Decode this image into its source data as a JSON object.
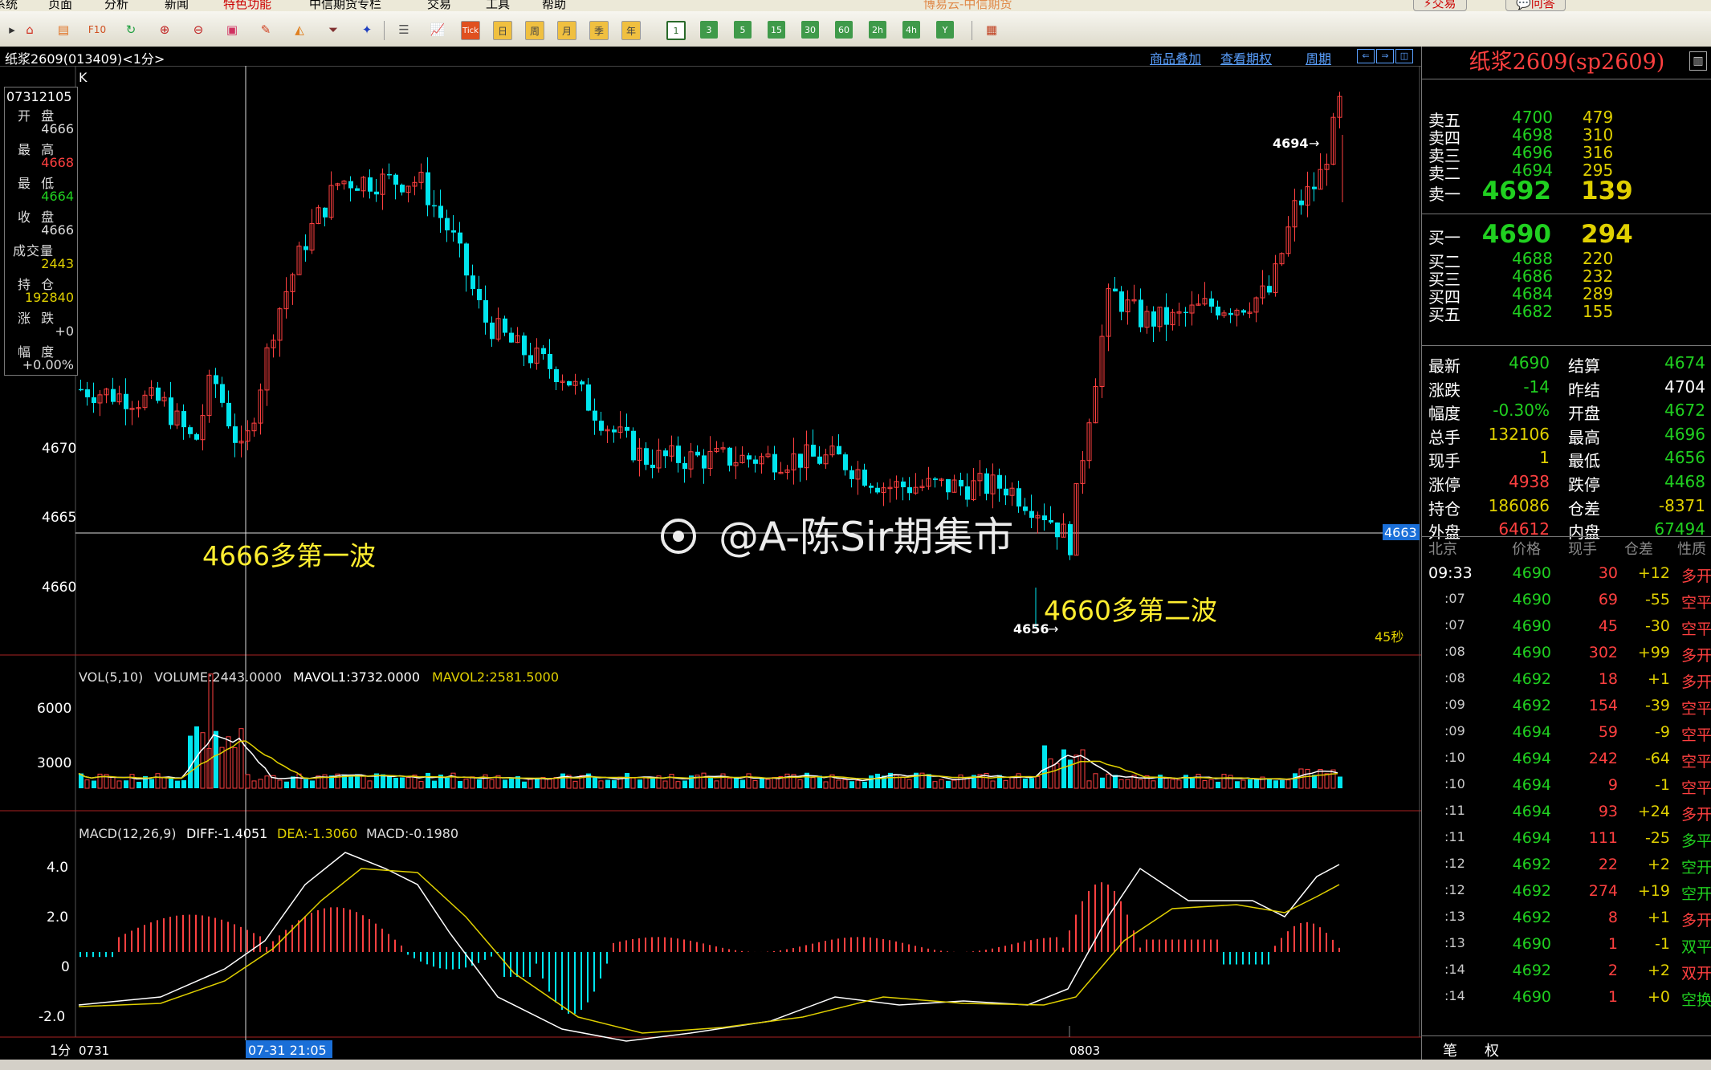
{
  "menu": {
    "items": [
      "系统",
      "页面",
      "分析",
      "新闻",
      "特色功能",
      "中信期货专栏",
      "交易",
      "工具",
      "帮助"
    ],
    "app_title": "博易云-中信期货",
    "trade_btn": "交易",
    "ask_btn": "问答"
  },
  "toolbar": {
    "periods": [
      "1",
      "3",
      "5",
      "15",
      "30",
      "60",
      "2h",
      "4h",
      "Y"
    ],
    "selected_period": "1",
    "tick_label": "Tick",
    "day_label": "日",
    "week_label": "周",
    "month_label": "月",
    "season_label": "季",
    "year_label": "年"
  },
  "chart": {
    "title": "纸浆2609(013409)<1分>",
    "links": {
      "overlay": "商品叠加",
      "options": "查看期权",
      "period": "周期"
    },
    "k_label": "K",
    "price_labels": [
      "4670",
      "4665",
      "4660"
    ],
    "vol_labels": [
      "6000",
      "3000"
    ],
    "macd_labels": [
      "4.0",
      "2.0",
      "0",
      "-2.0"
    ],
    "high_marker": "4694",
    "low_marker": "4656",
    "crosshair_price": "4663",
    "countdown": "45秒",
    "annotation1": "4666多第一波",
    "annotation2": "4660多第二波",
    "watermark": "@A-陈Sir期集市",
    "vol_info": {
      "name": "VOL(5,10)",
      "volume": "VOLUME:2443.0000",
      "mavol1": "MAVOL1:3732.0000",
      "mavol2": "MAVOL2:2581.5000"
    },
    "macd_info": {
      "name": "MACD(12,26,9)",
      "diff": "DIFF:-1.4051",
      "dea": "DEA:-1.3060",
      "macd": "MACD:-0.1980"
    },
    "axis": {
      "period": "1分",
      "date1": "0731",
      "cursor_time": "07-31 21:05",
      "date2": "0803"
    },
    "colors": {
      "up": "#ff4040",
      "down": "#00e5ee",
      "ma1": "#ffffff",
      "ma2": "#e0d000",
      "bg": "#000000"
    }
  },
  "data_window": {
    "time": "07312105",
    "labels": [
      "开 盘",
      "最 高",
      "最 低",
      "收 盘",
      "成交量",
      "持 仓",
      "涨 跌",
      "幅 度"
    ],
    "values": [
      "4666",
      "4668",
      "4664",
      "4666",
      "2443",
      "192840",
      "+0",
      "+0.00%"
    ],
    "value_colors": [
      "#dddddd",
      "#ff4040",
      "#20d020",
      "#dddddd",
      "#e0d000",
      "#e0d000",
      "#dddddd",
      "#dddddd"
    ]
  },
  "quote": {
    "title": "纸浆2609(sp2609)",
    "asks": [
      {
        "label": "卖五",
        "price": "4700",
        "vol": "479"
      },
      {
        "label": "卖四",
        "price": "4698",
        "vol": "310"
      },
      {
        "label": "卖三",
        "price": "4696",
        "vol": "316"
      },
      {
        "label": "卖二",
        "price": "4694",
        "vol": "295"
      },
      {
        "label": "卖一",
        "price": "4692",
        "vol": "139"
      }
    ],
    "bids": [
      {
        "label": "买一",
        "price": "4690",
        "vol": "294"
      },
      {
        "label": "买二",
        "price": "4688",
        "vol": "220"
      },
      {
        "label": "买三",
        "price": "4686",
        "vol": "232"
      },
      {
        "label": "买四",
        "price": "4684",
        "vol": "289"
      },
      {
        "label": "买五",
        "price": "4682",
        "vol": "155"
      }
    ],
    "stats": [
      {
        "l1": "最新",
        "v1": "4690",
        "c1": "#20d020",
        "l2": "结算",
        "v2": "4674",
        "c2": "#20d020"
      },
      {
        "l1": "涨跌",
        "v1": "-14",
        "c1": "#20d020",
        "l2": "昨结",
        "v2": "4704",
        "c2": "#ffffff"
      },
      {
        "l1": "幅度",
        "v1": "-0.30%",
        "c1": "#20d020",
        "l2": "开盘",
        "v2": "4672",
        "c2": "#20d020"
      },
      {
        "l1": "总手",
        "v1": "132106",
        "c1": "#e0d000",
        "l2": "最高",
        "v2": "4696",
        "c2": "#20d020"
      },
      {
        "l1": "现手",
        "v1": "1",
        "c1": "#e0d000",
        "l2": "最低",
        "v2": "4656",
        "c2": "#20d020"
      },
      {
        "l1": "涨停",
        "v1": "4938",
        "c1": "#ff4040",
        "l2": "跌停",
        "v2": "4468",
        "c2": "#20d020"
      },
      {
        "l1": "持仓",
        "v1": "186086",
        "c1": "#e0d000",
        "l2": "仓差",
        "v2": "-8371",
        "c2": "#e0d000"
      },
      {
        "l1": "外盘",
        "v1": "64612",
        "c1": "#ff4040",
        "l2": "内盘",
        "v2": "67494",
        "c2": "#20d020"
      }
    ],
    "tick_headers": [
      "北京",
      "价格",
      "现手",
      "仓差",
      "性质"
    ],
    "ticks": [
      {
        "t": "09:33",
        "p": "4690",
        "v": "30",
        "d": "+12",
        "n": "多开",
        "nc": "#ff4040"
      },
      {
        "t": ":07",
        "p": "4690",
        "v": "69",
        "d": "-55",
        "n": "空平",
        "nc": "#ff4040"
      },
      {
        "t": ":07",
        "p": "4690",
        "v": "45",
        "d": "-30",
        "n": "空平",
        "nc": "#ff4040"
      },
      {
        "t": ":08",
        "p": "4690",
        "v": "302",
        "d": "+99",
        "n": "多开",
        "nc": "#ff4040"
      },
      {
        "t": ":08",
        "p": "4692",
        "v": "18",
        "d": "+1",
        "n": "多开",
        "nc": "#ff4040"
      },
      {
        "t": ":09",
        "p": "4692",
        "v": "154",
        "d": "-39",
        "n": "空平",
        "nc": "#ff4040"
      },
      {
        "t": ":09",
        "p": "4694",
        "v": "59",
        "d": "-9",
        "n": "空平",
        "nc": "#ff4040"
      },
      {
        "t": ":10",
        "p": "4694",
        "v": "242",
        "d": "-64",
        "n": "空平",
        "nc": "#ff4040"
      },
      {
        "t": ":10",
        "p": "4694",
        "v": "9",
        "d": "-1",
        "n": "空平",
        "nc": "#ff4040"
      },
      {
        "t": ":11",
        "p": "4694",
        "v": "93",
        "d": "+24",
        "n": "多开",
        "nc": "#ff4040"
      },
      {
        "t": ":11",
        "p": "4694",
        "v": "111",
        "d": "-25",
        "n": "多平",
        "nc": "#20d020"
      },
      {
        "t": ":12",
        "p": "4692",
        "v": "22",
        "d": "+2",
        "n": "空开",
        "nc": "#20d020"
      },
      {
        "t": ":12",
        "p": "4692",
        "v": "274",
        "d": "+19",
        "n": "空开",
        "nc": "#20d020"
      },
      {
        "t": ":13",
        "p": "4692",
        "v": "8",
        "d": "+1",
        "n": "多开",
        "nc": "#ff4040"
      },
      {
        "t": ":13",
        "p": "4690",
        "v": "1",
        "d": "-1",
        "n": "双平",
        "nc": "#20d020"
      },
      {
        "t": ":14",
        "p": "4692",
        "v": "2",
        "d": "+2",
        "n": "双开",
        "nc": "#ff4040"
      },
      {
        "t": ":14",
        "p": "4690",
        "v": "1",
        "d": "+0",
        "n": "空换",
        "nc": "#20d020"
      }
    ],
    "tabs": [
      "笔",
      "权"
    ]
  }
}
